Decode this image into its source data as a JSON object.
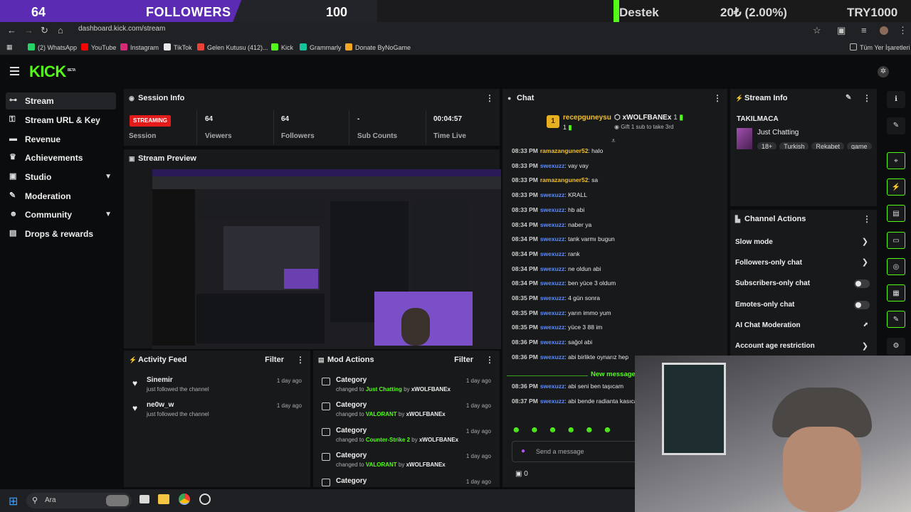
{
  "overlay": {
    "goal_current": "64",
    "goal_label": "FOLLOWERS",
    "goal_target": "100",
    "goal_progress_percent": 64,
    "donate_label": "Destek",
    "donate_amount": "20₺ (2.00%)",
    "donate_target": "TRY1000"
  },
  "browser": {
    "url": "dashboard.kick.com/stream",
    "bookmarks": [
      {
        "label": "(2) WhatsApp",
        "color": "#25d366"
      },
      {
        "label": "YouTube",
        "color": "#ff0000"
      },
      {
        "label": "Instagram",
        "color": "#d62976"
      },
      {
        "label": "TikTok",
        "color": "#e8e8e8"
      },
      {
        "label": "Gelen Kutusu (412)...",
        "color": "#ea4335"
      },
      {
        "label": "Kick",
        "color": "#53fc18"
      },
      {
        "label": "Grammarly",
        "color": "#15c39a"
      },
      {
        "label": "Donate ByNoGame",
        "color": "#f5a623"
      }
    ],
    "other_bookmarks": "Tüm Yer İşaretleri"
  },
  "app": {
    "logo": "KICK",
    "logo_badge": "BETA"
  },
  "sidebar": {
    "items": [
      {
        "label": "Stream",
        "icon": "stream-icon"
      },
      {
        "label": "Stream URL & Key",
        "icon": "key-icon"
      },
      {
        "label": "Revenue",
        "icon": "revenue-icon"
      },
      {
        "label": "Achievements",
        "icon": "trophy-icon"
      },
      {
        "label": "Studio",
        "icon": "studio-icon"
      },
      {
        "label": "Moderation",
        "icon": "wrench-icon"
      },
      {
        "label": "Community",
        "icon": "community-icon"
      },
      {
        "label": "Drops & rewards",
        "icon": "drops-icon"
      }
    ]
  },
  "session": {
    "title": "Session Info",
    "status": "STREAMING",
    "status_label": "Session",
    "viewers": "64",
    "viewers_label": "Viewers",
    "followers": "64",
    "followers_label": "Followers",
    "subs": "-",
    "subs_label": "Sub Counts",
    "time": "00:04:57",
    "time_label": "Time Live"
  },
  "preview": {
    "title": "Stream Preview"
  },
  "activity": {
    "title": "Activity Feed",
    "filter": "Filter",
    "items": [
      {
        "name": "Sinemir",
        "text": "just followed the channel",
        "time": "1 day ago"
      },
      {
        "name": "ne0w_w",
        "text": "just followed the channel",
        "time": "1 day ago"
      }
    ]
  },
  "mod": {
    "title": "Mod Actions",
    "filter": "Filter",
    "changed": "changed to",
    "by": "by",
    "items": [
      {
        "type": "Category",
        "value": "Just Chatting",
        "user": "xWOLFBANEx",
        "time": "1 day ago"
      },
      {
        "type": "Category",
        "value": "VALORANT",
        "user": "xWOLFBANEx",
        "time": "1 day ago"
      },
      {
        "type": "Category",
        "value": "Counter-Strike 2",
        "user": "xWOLFBANEx",
        "time": "1 day ago"
      },
      {
        "type": "Category",
        "value": "VALORANT",
        "user": "xWOLFBANEx",
        "time": "1 day ago"
      },
      {
        "type": "Category",
        "value": "",
        "user": "",
        "time": "1 day ago"
      }
    ]
  },
  "chat": {
    "title": "Chat",
    "pinned_rank": "1",
    "pinned_user": "recepguneysu",
    "pinned_count": "1",
    "gifter": "xWOLFBANEx",
    "gifter_count": "1",
    "gift_text": "Gift 1 sub to take 3rd",
    "new_message": "New message",
    "input_placeholder": "Send a message",
    "viewer_count": "0",
    "messages": [
      {
        "time": "08:33 PM",
        "user": "ramazanguner52",
        "text": "halo",
        "color": "#f0c030"
      },
      {
        "time": "08:33 PM",
        "user": "swexuzz",
        "text": "vay vay",
        "color": "#5b8cff"
      },
      {
        "time": "08:33 PM",
        "user": "ramazanguner52",
        "text": "sa",
        "color": "#f0c030"
      },
      {
        "time": "08:33 PM",
        "user": "swexuzz",
        "text": "KRALL",
        "color": "#5b8cff"
      },
      {
        "time": "08:33 PM",
        "user": "swexuzz",
        "text": "hb abi",
        "color": "#5b8cff"
      },
      {
        "time": "08:34 PM",
        "user": "swexuzz",
        "text": "naber ya",
        "color": "#5b8cff"
      },
      {
        "time": "08:34 PM",
        "user": "swexuzz",
        "text": "tank varmı bugun",
        "color": "#5b8cff"
      },
      {
        "time": "08:34 PM",
        "user": "swexuzz",
        "text": "rank",
        "color": "#5b8cff"
      },
      {
        "time": "08:34 PM",
        "user": "swexuzz",
        "text": "ne oldun abi",
        "color": "#5b8cff"
      },
      {
        "time": "08:34 PM",
        "user": "swexuzz",
        "text": "ben yüce 3 oldum",
        "color": "#5b8cff"
      },
      {
        "time": "08:35 PM",
        "user": "swexuzz",
        "text": "4 gün sonra",
        "color": "#5b8cff"
      },
      {
        "time": "08:35 PM",
        "user": "swexuzz",
        "text": "yarın immo yum",
        "color": "#5b8cff"
      },
      {
        "time": "08:35 PM",
        "user": "swexuzz",
        "text": "yüce 3 88 im",
        "color": "#5b8cff"
      },
      {
        "time": "08:36 PM",
        "user": "swexuzz",
        "text": "sağol abi",
        "color": "#5b8cff"
      },
      {
        "time": "08:36 PM",
        "user": "swexuzz",
        "text": "abi birlikte oynarız hep",
        "color": "#5b8cff"
      }
    ],
    "messages_after": [
      {
        "time": "08:36 PM",
        "user": "swexuzz",
        "text": "abi seni ben taşıcam",
        "color": "#5b8cff"
      },
      {
        "time": "08:37 PM",
        "user": "swexuzz",
        "text": "abi bende radianta kasıcam",
        "color": "#5b8cff"
      }
    ]
  },
  "stream_info": {
    "title": "Stream Info",
    "stream_title": "TAKILMACA",
    "category": "Just Chatting",
    "tags": [
      "18+",
      "Turkish",
      "Rekabet",
      "game"
    ]
  },
  "channel_actions": {
    "title": "Channel Actions",
    "items": [
      {
        "label": "Slow mode",
        "kind": "chevron"
      },
      {
        "label": "Followers-only chat",
        "kind": "chevron"
      },
      {
        "label": "Subscribers-only chat",
        "kind": "toggle"
      },
      {
        "label": "Emotes-only chat",
        "kind": "toggle"
      },
      {
        "label": "AI Chat Moderation",
        "kind": "external"
      },
      {
        "label": "Account age restriction",
        "kind": "chevron"
      }
    ]
  },
  "taskbar": {
    "search_placeholder": "Ara"
  }
}
